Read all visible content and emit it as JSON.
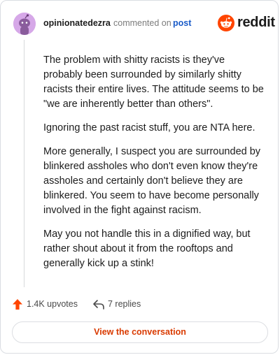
{
  "header": {
    "username": "opinionatedezra",
    "commented_on": "commented on",
    "post_link": "post",
    "brand": "reddit"
  },
  "comment": {
    "paragraphs": [
      "The problem with shitty racists is they've probably been surrounded by similarly shitty racists their entire lives. The attitude seems to be \"we are inherently better than others\".",
      "Ignoring the past racist stuff, you are NTA here.",
      "More generally, I suspect you are surrounded by blinkered assholes who don't even know they're assholes and certainly don't believe they are blinkered. You seem to have become personally involved in the fight against racism.",
      "May you not handle this in a dignified way, but rather shout about it from the rooftops and generally kick up a stink!"
    ]
  },
  "actions": {
    "upvotes": "1.4K upvotes",
    "replies": "7 replies"
  },
  "footer": {
    "view_button": "View the conversation"
  },
  "colors": {
    "accent": "#d93a00",
    "reddit_orange": "#ff4500",
    "link_blue": "#1a5bc8",
    "avatar_bg": "#d6a8e8"
  },
  "icons": {
    "avatar": "snoo-avatar-icon",
    "brand": "reddit-logo-icon",
    "upvote": "upvote-arrow-icon",
    "reply": "reply-arrow-icon"
  }
}
